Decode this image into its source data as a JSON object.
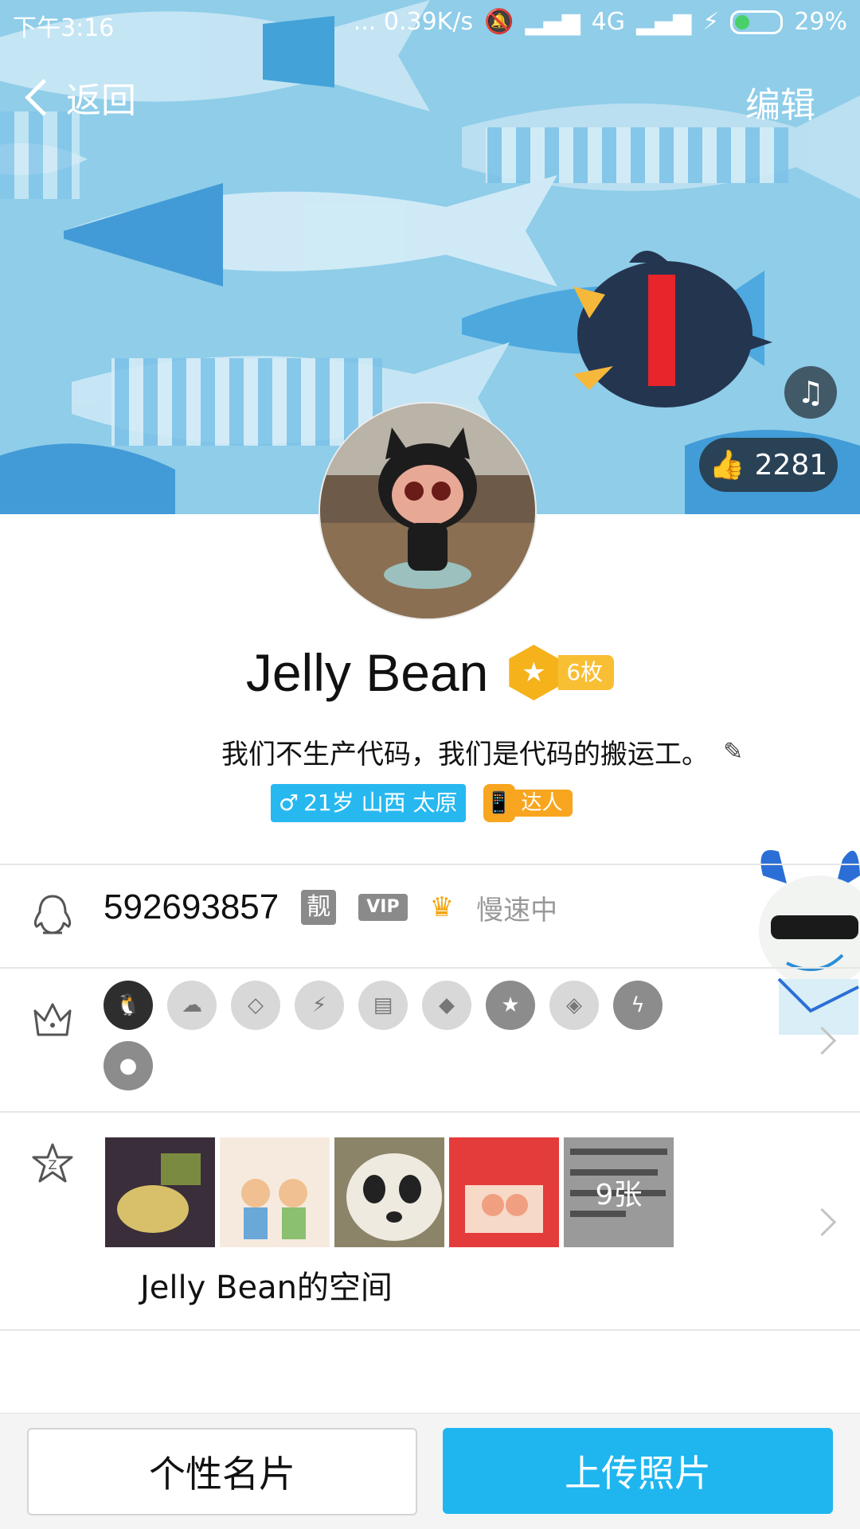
{
  "status_bar": {
    "time": "下午3:16",
    "net_speed": "... 0.39K/s",
    "network": "4G",
    "battery": "29%"
  },
  "top_bar": {
    "back_label": "返回",
    "edit_label": "编辑"
  },
  "cover": {
    "like_count": "2281",
    "music_icon": "music-toggle-icon"
  },
  "profile": {
    "name": "Jelly Bean",
    "medal_count": "6枚",
    "signature": "我们不生产代码，我们是代码的搬运工。",
    "age_location": "21岁 山西 太原",
    "daren_label": "达人"
  },
  "qq_row": {
    "qq_number": "592693857",
    "liang_badge": "靓",
    "vip_badge": "VIP",
    "status": "慢速中"
  },
  "growth_row": {
    "icons": [
      "qq-penguin-icon",
      "weiyun-icon",
      "diamond-lv1-icon",
      "lightning-diamond-icon",
      "book-icon",
      "red-diamond-icon",
      "star-icon",
      "pink-diamond-icon",
      "speed-icon",
      "penguin-small-icon"
    ]
  },
  "space_row": {
    "title": "Jelly Bean的空间",
    "photo_count": "9张"
  },
  "bottom_bar": {
    "card_button": "个性名片",
    "upload_button": "上传照片"
  },
  "colors": {
    "accent": "#1fb6f0",
    "cover_bg": "#8fcde9",
    "medal": "#f5b21b"
  }
}
